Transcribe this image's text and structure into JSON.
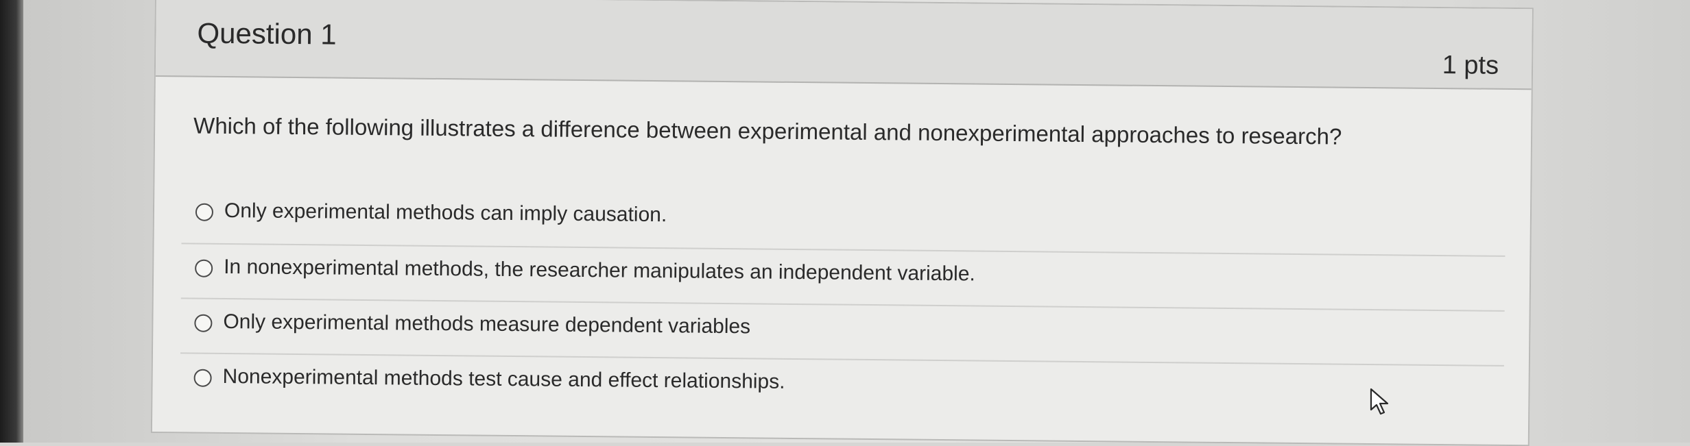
{
  "question": {
    "title": "Question 1",
    "points": "1 pts",
    "text": "Which of the following illustrates a difference between experimental and nonexperimental approaches to research?",
    "options": [
      {
        "label": "Only experimental methods can imply causation.",
        "selected": false
      },
      {
        "label": "In nonexperimental methods, the researcher manipulates an independent variable.",
        "selected": false
      },
      {
        "label": "Only experimental methods measure dependent variables",
        "selected": false
      },
      {
        "label": "Nonexperimental methods test cause and effect relationships.",
        "selected": false
      }
    ]
  },
  "cursor": {
    "icon": "mouse-pointer-icon"
  }
}
